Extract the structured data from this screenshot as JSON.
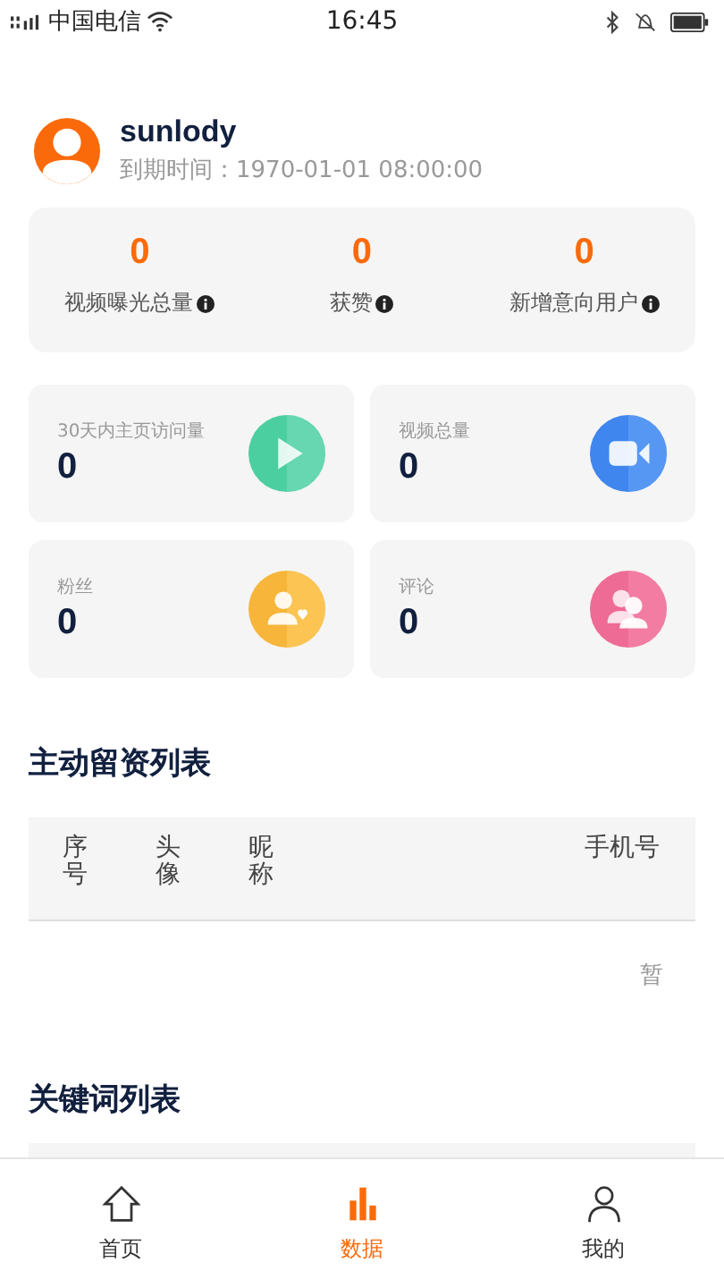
{
  "status_bar": {
    "carrier": "中国电信",
    "time": "16:45"
  },
  "profile": {
    "name": "sunlody",
    "expiry": "到期时间：1970-01-01 08:00:00"
  },
  "summary": [
    {
      "value": "0",
      "label": "视频曝光总量"
    },
    {
      "value": "0",
      "label": "获赞"
    },
    {
      "value": "0",
      "label": "新增意向用户"
    }
  ],
  "tiles": [
    {
      "label": "30天内主页访问量",
      "value": "0",
      "kind": "play"
    },
    {
      "label": "视频总量",
      "value": "0",
      "kind": "video"
    },
    {
      "label": "粉丝",
      "value": "0",
      "kind": "fans"
    },
    {
      "label": "评论",
      "value": "0",
      "kind": "comments"
    }
  ],
  "leads_table": {
    "title": "主动留资列表",
    "columns": [
      "序号",
      "头像",
      "昵称",
      "手机号"
    ],
    "empty_text": "暂"
  },
  "keywords_table": {
    "title": "关键词列表"
  },
  "tab_bar": [
    {
      "label": "首页",
      "kind": "home",
      "selected": false
    },
    {
      "label": "数据",
      "kind": "data",
      "selected": true
    },
    {
      "label": "我的",
      "kind": "me",
      "selected": false
    }
  ]
}
